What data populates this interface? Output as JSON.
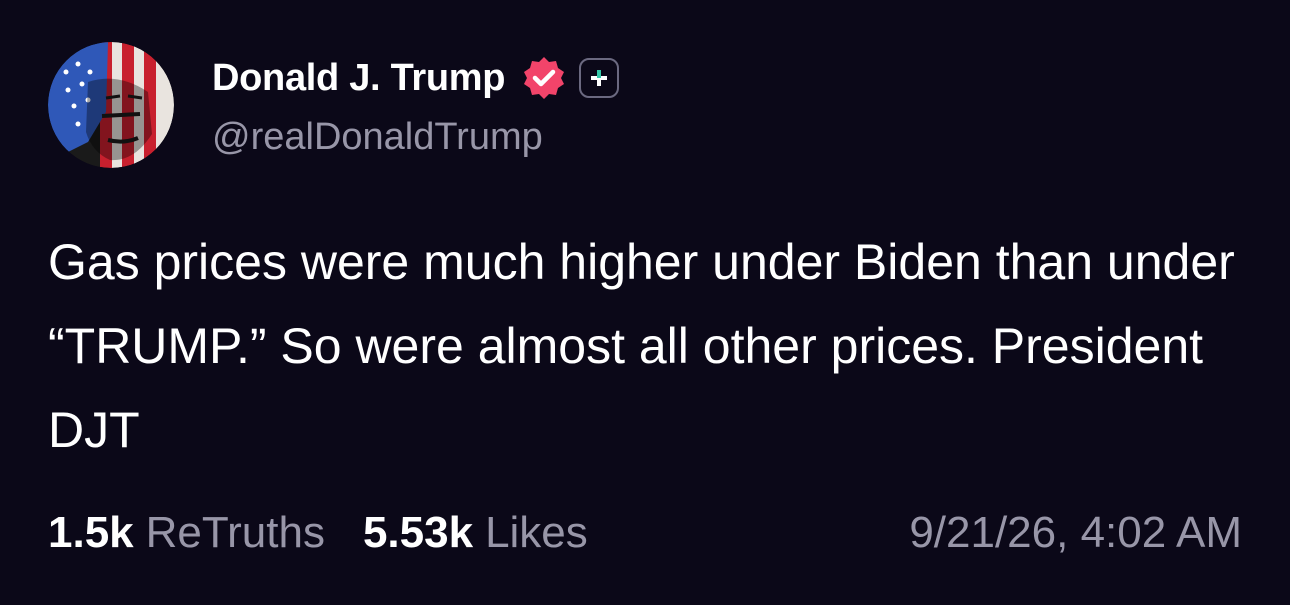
{
  "post": {
    "author": {
      "display_name": "Donald J. Trump",
      "handle": "@realDonaldTrump",
      "verified_icon": "verified-badge-icon",
      "plus_icon": "plus-badge-icon"
    },
    "text": "Gas prices were much higher under Biden than under “TRUMP.” So were almost all other prices. President DJT",
    "retruths_count": "1.5k",
    "retruths_label": "ReTruths",
    "likes_count": "5.53k",
    "likes_label": "Likes",
    "timestamp": "9/21/26, 4:02 AM"
  },
  "colors": {
    "background": "#0b0818",
    "verified": "#f2446a",
    "muted_text": "#9896a8"
  }
}
